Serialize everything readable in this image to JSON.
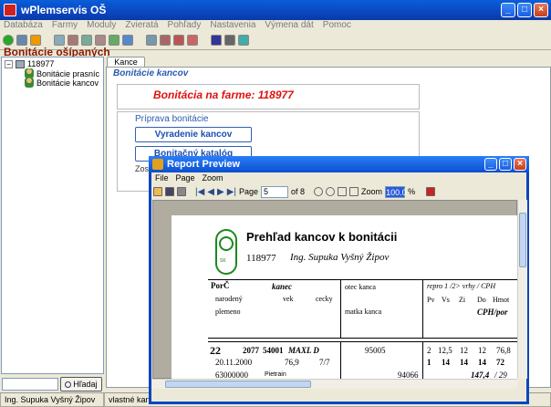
{
  "app": {
    "title": "wPlemservis OŠ"
  },
  "menu": [
    "Databáza",
    "Farmy",
    "Moduly",
    "Zvieratá",
    "Pohľady",
    "Nastavenia",
    "Výmena dát",
    "Pomoc"
  ],
  "page_title": "Bonitácie ošípaných",
  "tree": {
    "root": "118977",
    "children": [
      "Bonitácie prasníc",
      "Bonitácie kancov"
    ]
  },
  "search": {
    "value": "",
    "button": "Hľadaj"
  },
  "status": {
    "user": "Ing. Supuka Vyšný Žipov",
    "panel2": "vlastné kance n"
  },
  "tab": "Kance",
  "section_label": "Bonitácie kancov",
  "farm_title": "Bonitácia na farme: 118977",
  "priprava": {
    "label": "Príprava bonitácie",
    "btn1": "Vyradenie kancov",
    "btn2": "Bonitačný katalóg",
    "cut": "Zos"
  },
  "report_preview": {
    "title": "Report Preview",
    "menu": [
      "File",
      "Page",
      "Zoom"
    ],
    "page_label": "Page",
    "page_value": "5",
    "of": "of 8",
    "zoom_label": "Zoom",
    "zoom_value": "100.0",
    "percent": "%"
  },
  "report": {
    "heading": "Prehľad kancov k bonitácii",
    "farm": "118977",
    "owner": "Ing. Supuka Vyšný Žipov",
    "hdr": {
      "porc": "PorČ",
      "kanec": "kanec",
      "narodeny": "narodený",
      "vek": "vek",
      "cecky": "cecky",
      "plemeno": "plemeno",
      "otec": "otec kanca",
      "matka": "matka kanca",
      "repro": "repro 1 /2> vrhy / CPH",
      "pv": "Pv",
      "vs": "Vs",
      "zi": "Zi",
      "do": "Do",
      "hmot": "Hmot",
      "cph": "CPH/por"
    },
    "row": {
      "porc": "22",
      "a": "2077",
      "b": "54001",
      "name": "MAXL D",
      "otec": "95005",
      "r1": [
        "2",
        "12,5",
        "12",
        "12",
        "76,8"
      ],
      "date": "20.11.2000",
      "vek": "76,9",
      "cecky": "7/7",
      "r2": [
        "1",
        "14",
        "14",
        "14",
        "72"
      ],
      "plemeno_code": "63000000",
      "plemeno": "Pietrain",
      "matka": "94066",
      "cph": "147,4",
      "por": "/ 29"
    }
  }
}
